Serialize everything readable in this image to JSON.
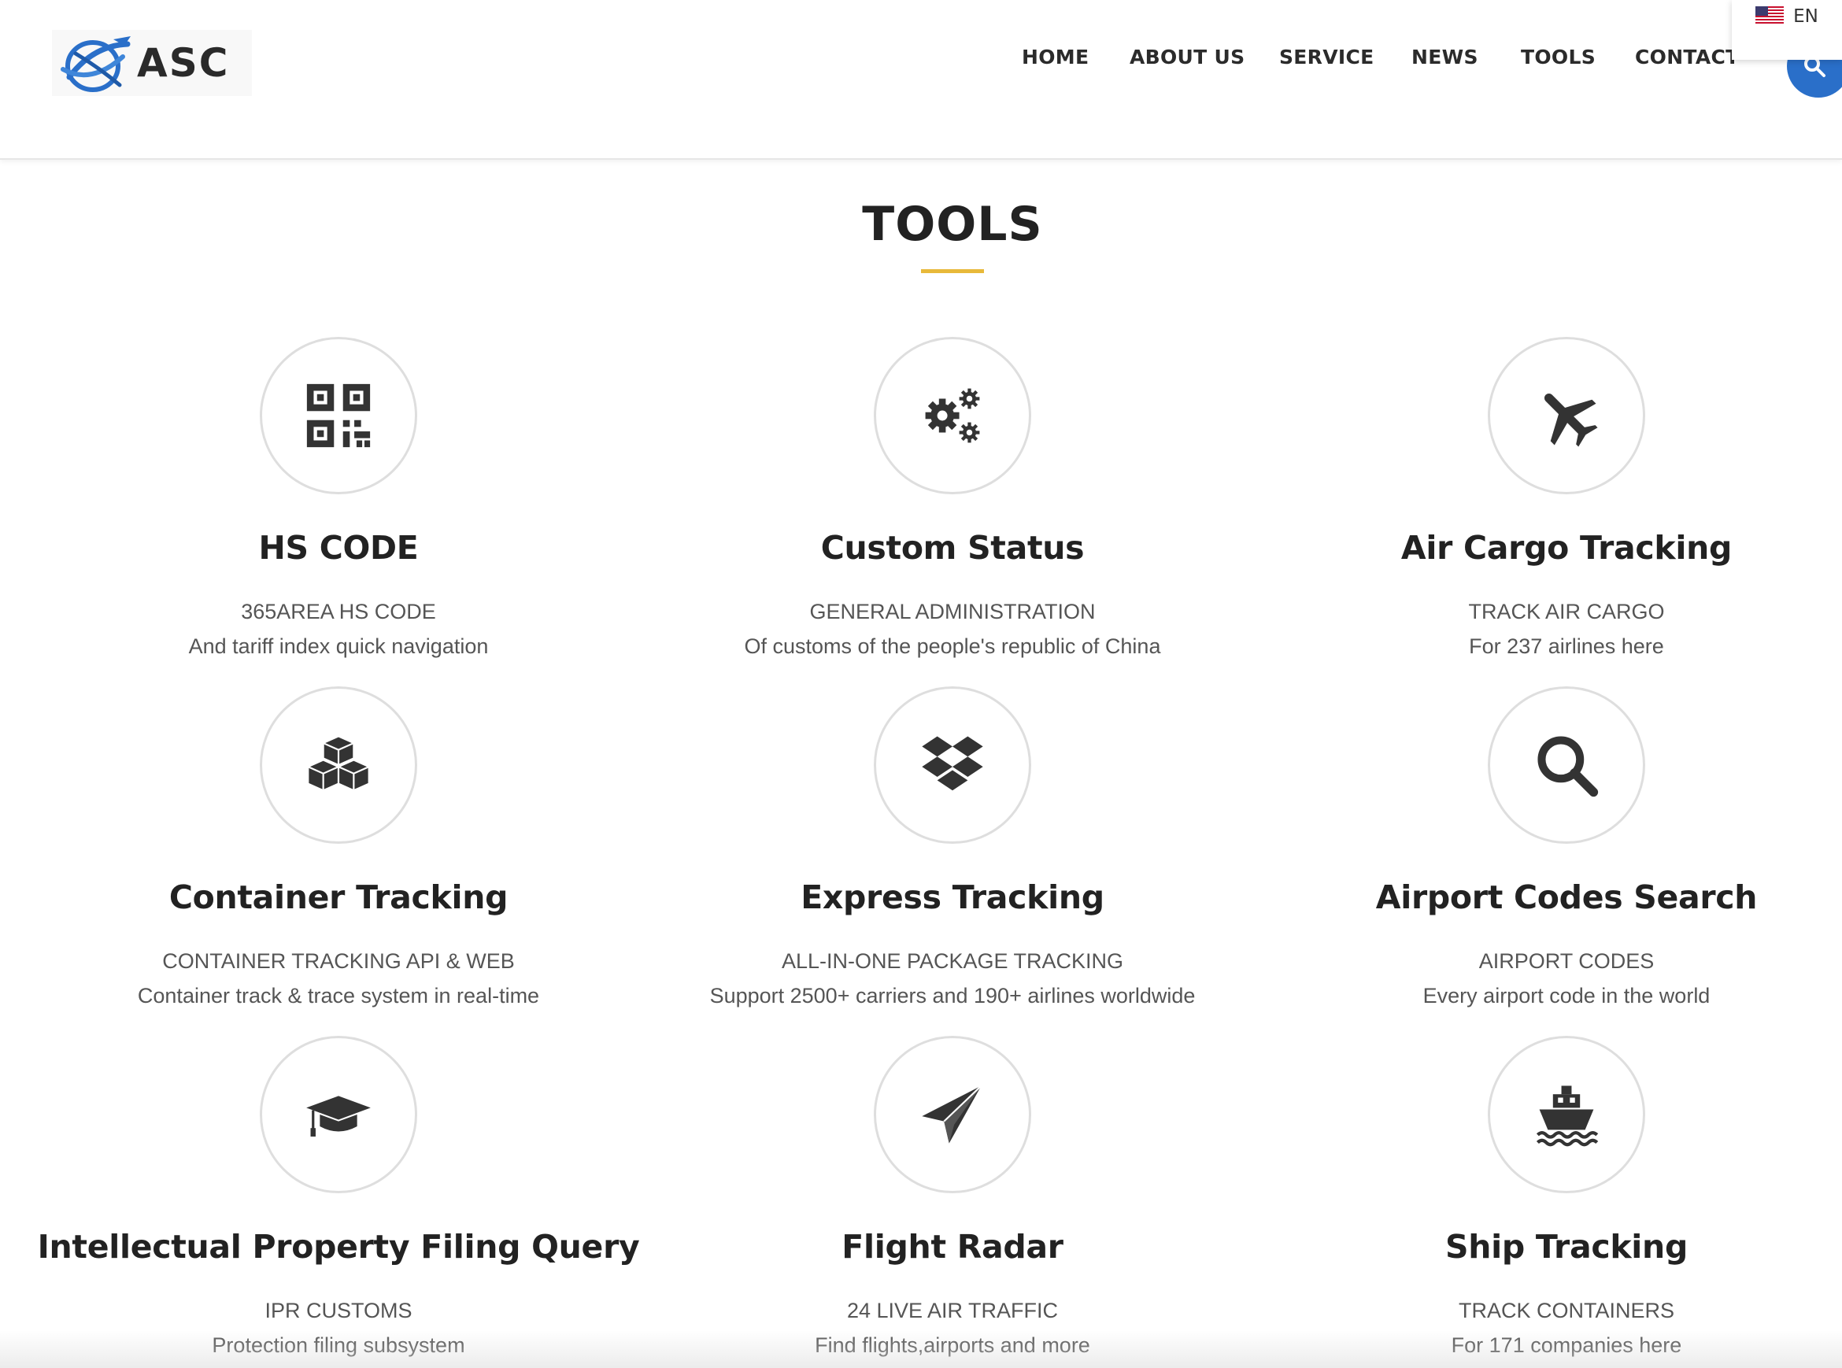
{
  "brand": {
    "logo_text": "ASC",
    "primary_color": "#2a6fc9",
    "accent_color": "#e8b93a"
  },
  "nav": {
    "items": [
      {
        "label": "HOME"
      },
      {
        "label": "ABOUT US"
      },
      {
        "label": "SERVICE"
      },
      {
        "label": "NEWS"
      },
      {
        "label": "TOOLS"
      },
      {
        "label": "CONTACT"
      }
    ]
  },
  "language": {
    "code": "EN",
    "flag_icon": "us-flag-icon"
  },
  "search": {
    "icon": "search-icon"
  },
  "section": {
    "title": "TOOLS"
  },
  "tools": [
    {
      "icon": "qrcode-icon",
      "title": "HS CODE",
      "line1": "365AREA HS CODE",
      "line2": "And tariff index quick navigation"
    },
    {
      "icon": "gears-icon",
      "title": "Custom Status",
      "line1": "GENERAL ADMINISTRATION",
      "line2": "Of customs of the people's republic of China"
    },
    {
      "icon": "plane-icon",
      "title": "Air Cargo Tracking",
      "line1": "TRACK AIR CARGO",
      "line2": "For 237 airlines here"
    },
    {
      "icon": "cubes-icon",
      "title": "Container Tracking",
      "line1": "CONTAINER TRACKING API & WEB",
      "line2": "Container track & trace system in real-time"
    },
    {
      "icon": "dropbox-icon",
      "title": "Express Tracking",
      "line1": "ALL-IN-ONE PACKAGE TRACKING",
      "line2": "Support 2500+ carriers and 190+ airlines worldwide"
    },
    {
      "icon": "search-icon",
      "title": "Airport Codes Search",
      "line1": "AIRPORT CODES",
      "line2": "Every airport code in the world"
    },
    {
      "icon": "graduation-cap-icon",
      "title": "Intellectual Property Filing Query",
      "line1": "IPR CUSTOMS",
      "line2": "Protection filing subsystem"
    },
    {
      "icon": "paper-plane-icon",
      "title": "Flight Radar",
      "line1": "24 LIVE AIR TRAFFIC",
      "line2": "Find flights,airports and more"
    },
    {
      "icon": "ship-icon",
      "title": "Ship Tracking",
      "line1": "TRACK CONTAINERS",
      "line2": "For 171 companies here"
    }
  ]
}
